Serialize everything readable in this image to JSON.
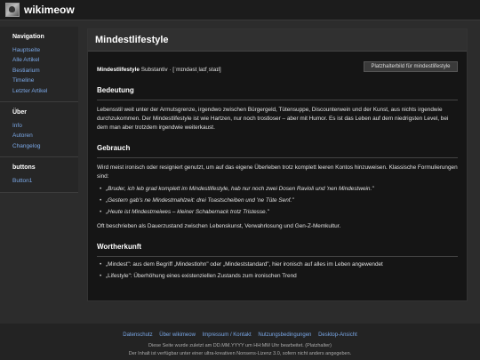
{
  "site": {
    "name": "wikimeow"
  },
  "sidebar": {
    "sections": [
      {
        "heading": "Navigation",
        "items": [
          "Hauptseite",
          "Alle Artikel",
          "Bestiarium",
          "Timeline",
          "Letzter Artikel"
        ]
      },
      {
        "heading": "Über",
        "items": [
          "Info",
          "Autoren",
          "Changelog"
        ]
      },
      {
        "heading": "buttons",
        "items": [
          "Button1"
        ]
      }
    ]
  },
  "article": {
    "title": "Mindestlifestyle",
    "lemma": {
      "word": "Mindestlifestyle",
      "rest": " Substantiv · [ˈmɪndəstˌlaɪfˌstaɪl]"
    },
    "image_placeholder": "Platzhalterbild für mindestlifestyle",
    "sections": {
      "bedeutung": {
        "heading": "Bedeutung",
        "text": "Lebensstil weit unter der Armutsgrenze, irgendwo zwischen Bürgergeld, Tütensuppe, Discounterwein und der Kunst, aus nichts irgendwie durchzukommen. Der Mindestlifestyle ist wie Hartzen, nur noch trostloser – aber mit Humor. Es ist das Leben auf dem niedrigsten Level, bei dem man aber trotzdem irgendwie weiterkaust."
      },
      "gebrauch": {
        "heading": "Gebrauch",
        "intro": "Wird meist ironisch oder resigniert genutzt, um auf das eigene Überleben trotz komplett leeren Kontos hinzuweisen. Klassische Formulierungen sind:",
        "examples": [
          "„Bruder, ich leb grad komplett im Mindestlifestyle, hab nur noch zwei Dosen Ravioli und 'nen Mindestwein.\"",
          "„Gestern gab's ne Mindestmahlzeit: drei Toastscheiben und 'ne Tüte Senf.\"",
          "„Heute ist Mindestmeiwes – kleiner Schabernack trotz Tristesse.\""
        ],
        "outro": "Oft beschrieben als Dauerzustand zwischen Lebenskunst, Verwahrlosung und Gen-Z-Memkultur."
      },
      "wortherkunft": {
        "heading": "Wortherkunft",
        "items": [
          "„Mindest\": aus dem Begriff „Mindestlohn\" oder „Mindeststandard\", hier ironisch auf alles im Leben angewendet",
          "„Lifestyle\": Überhöhung eines existenziellen Zustands zum ironischen Trend"
        ]
      }
    }
  },
  "footer": {
    "links": [
      "Datenschutz",
      "Über wikimeow",
      "Impressum / Kontakt",
      "Nutzungsbedingungen",
      "Desktop-Ansicht"
    ],
    "note": "Diese Seite wurde zuletzt am DD.MM.YYYY um HH:MM Uhr bearbeitet. (Platzhalter)",
    "license_prefix": "Der Inhalt ist verfügbar unter einer ",
    "license_link": "ultra-kreativen Nonsens-Lizenz 3.0",
    "license_suffix": ", sofern nicht anders angegeben."
  }
}
